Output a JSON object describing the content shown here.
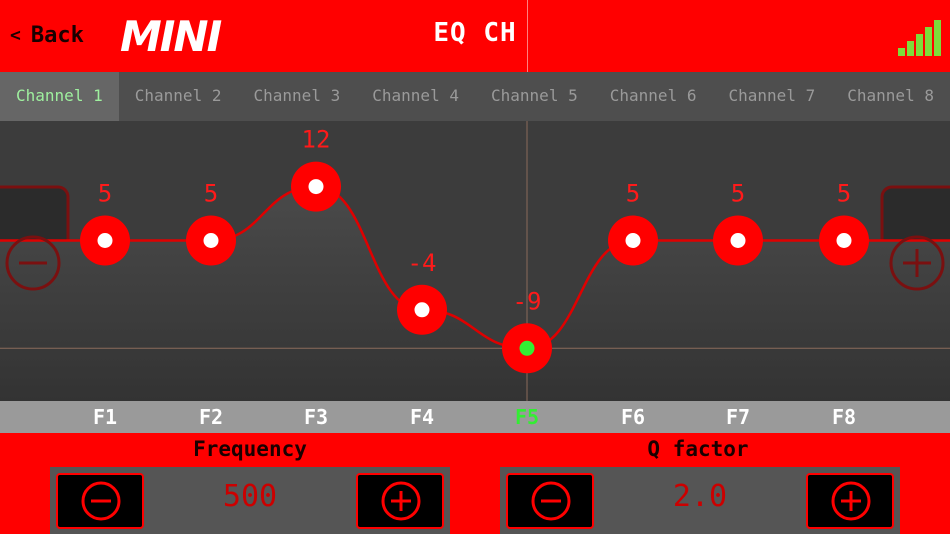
{
  "header": {
    "back_label": "Back",
    "back_icon": "chevron-left-icon",
    "logo": "MINI",
    "title": "EQ CH",
    "signal_icon": "signal-strength-icon"
  },
  "tabs": [
    {
      "label": "Channel 1",
      "active": true
    },
    {
      "label": "Channel 2",
      "active": false
    },
    {
      "label": "Channel 3",
      "active": false
    },
    {
      "label": "Channel 4",
      "active": false
    },
    {
      "label": "Channel 5",
      "active": false
    },
    {
      "label": "Channel 6",
      "active": false
    },
    {
      "label": "Channel 7",
      "active": false
    },
    {
      "label": "Channel 8",
      "active": false
    }
  ],
  "eq": {
    "filters": [
      {
        "label": "F1",
        "gain": 5
      },
      {
        "label": "F2",
        "gain": 5
      },
      {
        "label": "F3",
        "gain": 12
      },
      {
        "label": "F4",
        "gain": -4
      },
      {
        "label": "F5",
        "gain": -9
      },
      {
        "label": "F6",
        "gain": 5
      },
      {
        "label": "F7",
        "gain": 5
      },
      {
        "label": "F8",
        "gain": 5
      }
    ],
    "selected": "F5",
    "minus_icon": "minus-circle-icon",
    "plus_icon": "plus-circle-icon"
  },
  "controls": {
    "frequency": {
      "label": "Frequency",
      "value": "500"
    },
    "q_factor": {
      "label": "Q factor",
      "value": "2.0"
    }
  },
  "colors": {
    "accent": "#ff0000",
    "selected": "#33ee33",
    "active_tab_text": "#9ff09f"
  }
}
